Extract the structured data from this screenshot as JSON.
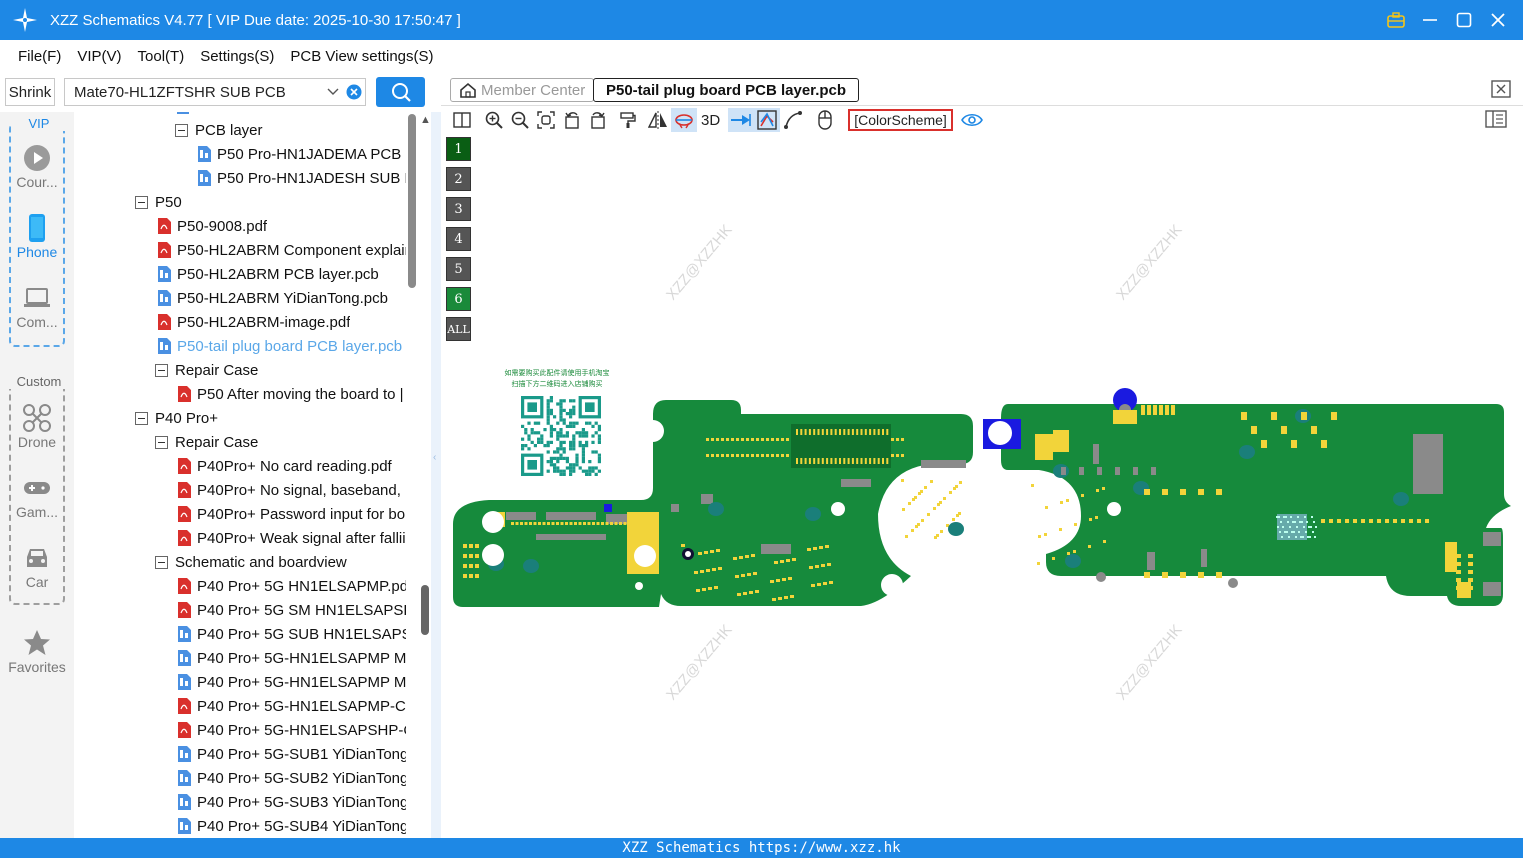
{
  "window": {
    "title": "XZZ Schematics V4.77 [ VIP Due date: 2025-10-30 17:50:47 ]"
  },
  "menu": [
    "File(F)",
    "VIP(V)",
    "Tool(T)",
    "Settings(S)",
    "PCB View settings(S)"
  ],
  "search": {
    "shrink_label": "Shrink",
    "value": "Mate70-HL1ZFTSHR SUB PCB"
  },
  "rail": {
    "vip_title": "VIP",
    "custom_title": "Custom",
    "categories": [
      "Cour...",
      "Phone",
      "Com...",
      "Drone",
      "Gam...",
      "Car",
      "Favorites"
    ]
  },
  "tree": [
    {
      "label": "PCB layer",
      "type": "folder"
    },
    {
      "label": "P50 Pro-HN1JADEMA PCB la",
      "type": "pcb"
    },
    {
      "label": "P50 Pro-HN1JADESH SUB PC",
      "type": "pcb"
    },
    {
      "label": "P50",
      "type": "folder"
    },
    {
      "label": "P50-9008.pdf",
      "type": "pdf"
    },
    {
      "label": "P50-HL2ABRM Component explair",
      "type": "pdf"
    },
    {
      "label": "P50-HL2ABRM PCB layer.pcb",
      "type": "pcb"
    },
    {
      "label": "P50-HL2ABRM YiDianTong.pcb",
      "type": "pcb"
    },
    {
      "label": "P50-HL2ABRM-image.pdf",
      "type": "pdf"
    },
    {
      "label": "P50-tail plug board PCB layer.pcb",
      "type": "pcb"
    },
    {
      "label": "Repair Case",
      "type": "folder"
    },
    {
      "label": "P50 After moving the board to |",
      "type": "pdf"
    },
    {
      "label": "P40 Pro+",
      "type": "folder"
    },
    {
      "label": "Repair Case",
      "type": "folder"
    },
    {
      "label": "P40Pro+ No card reading.pdf",
      "type": "pdf"
    },
    {
      "label": "P40Pro+ No signal, baseband, r",
      "type": "pdf"
    },
    {
      "label": "P40Pro+ Password input for bo",
      "type": "pdf"
    },
    {
      "label": "P40Pro+ Weak signal after fallii",
      "type": "pdf"
    },
    {
      "label": "Schematic and boardview",
      "type": "folder"
    },
    {
      "label": "P40 Pro+ 5G HN1ELSAPMP.pdf",
      "type": "pdf"
    },
    {
      "label": "P40 Pro+ 5G SM HN1ELSAPSHF",
      "type": "pdf"
    },
    {
      "label": "P40 Pro+ 5G SUB HN1ELSAPSH",
      "type": "pcb"
    },
    {
      "label": "P40 Pro+ 5G-HN1ELSAPMP MB",
      "type": "pcb"
    },
    {
      "label": "P40 Pro+ 5G-HN1ELSAPMP MB",
      "type": "pcb"
    },
    {
      "label": "P40 Pro+ 5G-HN1ELSAPMP-Coi",
      "type": "pdf"
    },
    {
      "label": "P40 Pro+ 5G-HN1ELSAPSHP-Cc",
      "type": "pdf"
    },
    {
      "label": "P40 Pro+ 5G-SUB1 YiDianTong.",
      "type": "pcb"
    },
    {
      "label": "P40 Pro+ 5G-SUB2 YiDianTong.",
      "type": "pcb"
    },
    {
      "label": "P40 Pro+ 5G-SUB3 YiDianTong.",
      "type": "pcb"
    },
    {
      "label": "P40 Pro+ 5G-SUB4 YiDianTong.",
      "type": "pcb"
    }
  ],
  "tabs": {
    "member_center": "Member Center",
    "active": "P50-tail plug board PCB layer.pcb"
  },
  "toolbar": {
    "three_d": "3D",
    "color_scheme": "[ColorScheme]"
  },
  "layers": [
    "1",
    "2",
    "3",
    "4",
    "5",
    "6",
    "ALL"
  ],
  "watermark": "XZZ@XZZHK",
  "qr_text_line1": "如需要购买此配件请使用手机淘宝",
  "qr_text_line2": "扫描下方二维码进入店铺购买",
  "status": "XZZ Schematics https://www.xzz.hk",
  "colors": {
    "accent": "#1e88e5",
    "board": "#168a3c",
    "pad": "#f2d43a"
  }
}
